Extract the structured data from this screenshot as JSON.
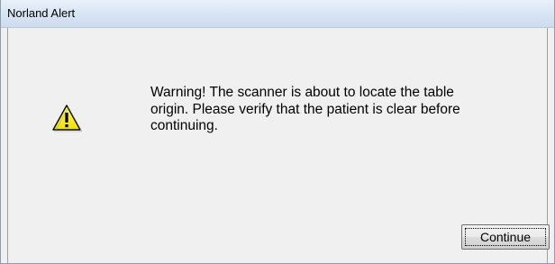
{
  "window": {
    "title": "Norland Alert"
  },
  "alert": {
    "icon": "warning-icon",
    "message": "Warning!  The scanner is about to locate the table\norigin.  Please verify that the patient is clear before\ncontinuing."
  },
  "buttons": {
    "continue_label": "Continue"
  },
  "colors": {
    "dialog_background": "#f0f0f0",
    "titlebar": "#d9e6f4",
    "warning_yellow": "#f6f21c"
  }
}
